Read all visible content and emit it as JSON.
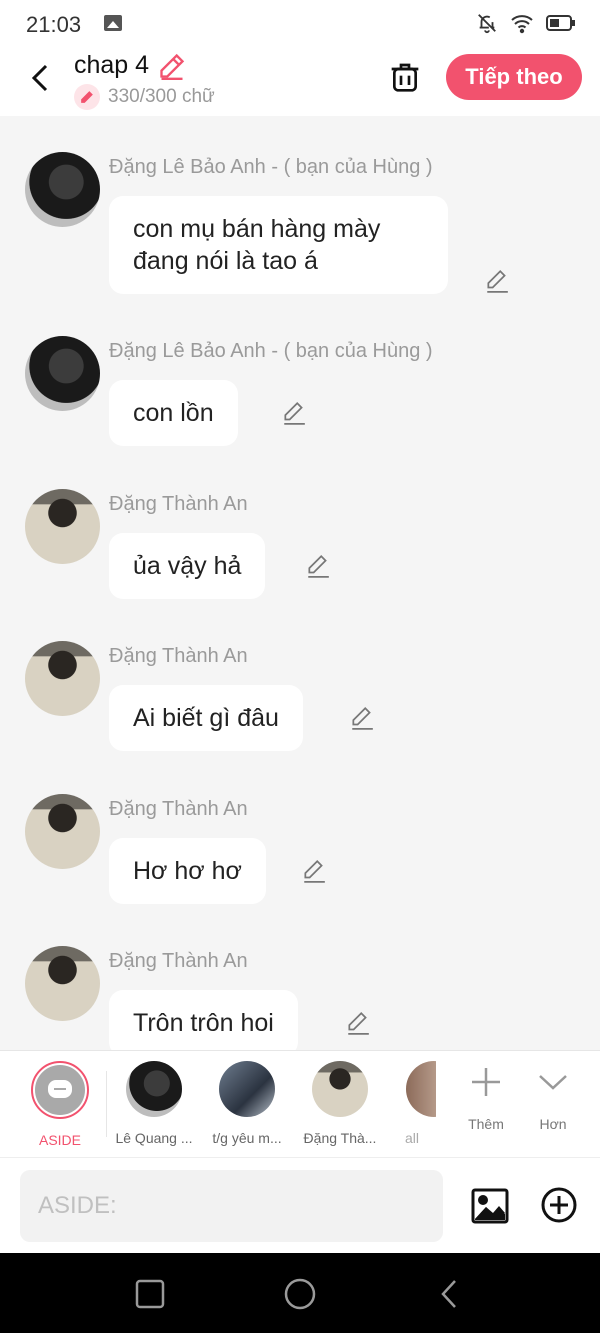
{
  "status": {
    "time": "21:03"
  },
  "header": {
    "title": "chap 4",
    "char_count": "330/300 chữ",
    "next_label": "Tiếp theo"
  },
  "messages": [
    {
      "sender": "Đặng Lê Bảo Anh - ( bạn của Hùng )",
      "text": "con mụ bán hàng mày\nđang nói là tao á",
      "avatar": "dark-jacket"
    },
    {
      "sender": "Đặng Lê Bảo Anh - ( bạn của Hùng )",
      "text": "con lồn",
      "avatar": "dark-jacket"
    },
    {
      "sender": "Đặng Thành An",
      "text": "ủa vậy hả",
      "avatar": "white-shirt-back"
    },
    {
      "sender": "Đặng Thành An",
      "text": "Ai biết gì đâu",
      "avatar": "white-shirt-back"
    },
    {
      "sender": "Đặng Thành An",
      "text": "Hơ hơ hơ",
      "avatar": "white-shirt-back"
    },
    {
      "sender": "Đặng Thành An",
      "text": "Trôn trôn hoi",
      "avatar": "white-shirt-back"
    }
  ],
  "characters": [
    {
      "name": "ASIDE",
      "selected": true
    },
    {
      "name": "Lê Quang ..."
    },
    {
      "name": "t/g yêu m..."
    },
    {
      "name": "Đặng Thà..."
    },
    {
      "name": "all"
    }
  ],
  "tools": {
    "more_label": "Thêm",
    "expand_label": "Hơn"
  },
  "input": {
    "placeholder": "ASIDE:"
  },
  "colors": {
    "accent": "#f2526e",
    "background": "#f5f5f5"
  }
}
